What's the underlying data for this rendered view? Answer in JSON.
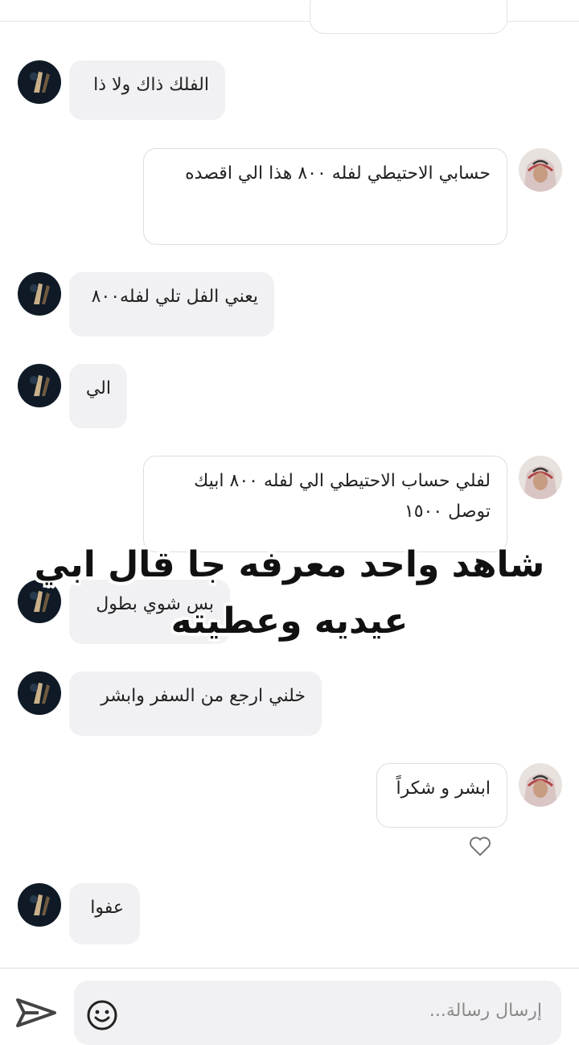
{
  "messages": [
    {
      "side": "in",
      "text": "الفلك ذاك ولا ذا"
    },
    {
      "side": "out",
      "text": "حسابي الاحتيطي لفله ٨٠٠ هذا الي اقصده"
    },
    {
      "side": "in",
      "text": "يعني الفل تلي لفله٨٠٠"
    },
    {
      "side": "in",
      "text": "الي"
    },
    {
      "side": "out",
      "text": "لفلي حساب الاحتيطي الي لفله ٨٠٠ ابيك توصل ١٥٠٠"
    },
    {
      "side": "in",
      "text": "بس شوي بطول"
    },
    {
      "side": "in",
      "text": "خلني ارجع من السفر وابشر"
    },
    {
      "side": "out",
      "text": "ابشر و شكراً"
    },
    {
      "side": "in",
      "text": "عفوا"
    }
  ],
  "overlay_caption": {
    "line1": "شاهد واحد معرفه جا قال ابي",
    "line2": "عيديه وعطيته"
  },
  "composer": {
    "placeholder": "إرسال رسالة..."
  },
  "icons": {
    "like": "heart-outline-icon",
    "emoji": "smiley-icon",
    "send": "paper-plane-icon"
  },
  "colors": {
    "incoming_bubble": "#f1f1f3",
    "outgoing_border": "#dddddd"
  }
}
